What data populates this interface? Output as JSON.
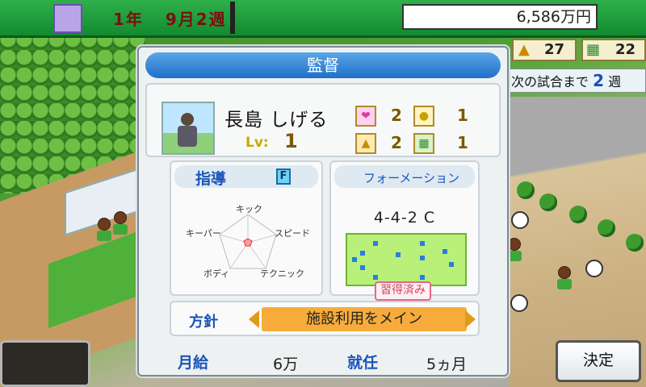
{
  "hud": {
    "date_year": "1年",
    "date_month": "9月",
    "date_week": "2週",
    "money": "6,586万円"
  },
  "side_hud": {
    "stat_a": "27",
    "stat_b": "22",
    "next_match_label": "次の試合まで",
    "next_match_weeks": "2",
    "next_match_unit": "週"
  },
  "dialog": {
    "title": "監督",
    "coach": {
      "name": "長島 しげる",
      "level_label": "Lv:",
      "level": "1",
      "stats": [
        {
          "icon": "heart-icon",
          "value": "2"
        },
        {
          "icon": "bulb-icon",
          "value": "1"
        },
        {
          "icon": "cone-icon",
          "value": "2"
        },
        {
          "icon": "field-icon",
          "value": "1"
        }
      ]
    },
    "coaching": {
      "label": "指導",
      "grade": "F",
      "radar_labels": [
        "キック",
        "スピード",
        "テクニック",
        "ボディ",
        "キーパー"
      ]
    },
    "formation": {
      "label": "フォーメーション",
      "value": "4-4-2 C",
      "badge": "習得済み"
    },
    "policy": {
      "label": "方針",
      "value": "施設利用をメイン"
    },
    "footer": {
      "salary_label": "月給",
      "salary_value": "6万",
      "tenure_label": "就任",
      "tenure_value": "5ヵ月"
    }
  },
  "buttons": {
    "decide": "決定"
  }
}
